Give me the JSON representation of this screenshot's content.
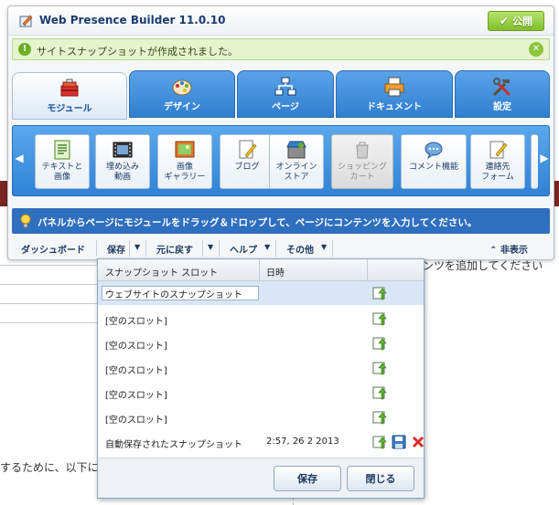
{
  "app": {
    "title": "Web Presence Builder 11.0.10",
    "publish_label": "公開"
  },
  "notice": {
    "text": "サイトスナップショットが作成されました。"
  },
  "tabs": [
    {
      "label": "モジュール",
      "icon": "toolbox-icon",
      "active": true
    },
    {
      "label": "デザイン",
      "icon": "palette-icon",
      "active": false
    },
    {
      "label": "ページ",
      "icon": "sitemap-icon",
      "active": false
    },
    {
      "label": "ドキュメント",
      "icon": "printer-icon",
      "active": false
    },
    {
      "label": "設定",
      "icon": "tools-icon",
      "active": false
    }
  ],
  "modules": [
    {
      "label": "テキストと画像",
      "lines": [
        "テキストと",
        "画像"
      ],
      "icon": "text-image-icon",
      "disabled": false
    },
    {
      "label": "埋め込み動画",
      "lines": [
        "埋め込み",
        "動画"
      ],
      "icon": "video-icon",
      "disabled": false
    },
    {
      "label": "画像ギャラリー",
      "lines": [
        "画像",
        "ギャラリー"
      ],
      "icon": "gallery-icon",
      "disabled": false
    },
    {
      "label": "ブログ",
      "lines": [
        "ブログ"
      ],
      "icon": "blog-icon",
      "disabled": false
    },
    {
      "label": "オンラインストア",
      "lines": [
        "オンライン",
        "ストア"
      ],
      "icon": "store-icon",
      "disabled": false
    },
    {
      "label": "ショッピングカート",
      "lines": [
        "ショッピング",
        "カート"
      ],
      "icon": "cart-icon",
      "disabled": true
    },
    {
      "label": "コメント機能",
      "lines": [
        "コメント機能"
      ],
      "icon": "comment-icon",
      "disabled": false
    },
    {
      "label": "連絡先フォーム",
      "lines": [
        "連絡先",
        "フォーム"
      ],
      "icon": "contact-form-icon",
      "disabled": false
    }
  ],
  "hint": {
    "text": "パネルからページにモジュールをドラッグ＆ドロップして、ページにコンテンツを入力してください。"
  },
  "toolbar": {
    "dashboard": "ダッシュボード",
    "save": "保存",
    "undo": "元に戻す",
    "help": "ヘルプ",
    "other": "その他",
    "hide": "非表示"
  },
  "snapshot_panel": {
    "col_slot": "スナップショット スロット",
    "col_date": "日時",
    "rows": [
      {
        "name": "ウェブサイトのスナップショット",
        "date": "",
        "editing": true,
        "autosave": false
      },
      {
        "name": "[空のスロット]",
        "date": "",
        "editing": false,
        "autosave": false
      },
      {
        "name": "[空のスロット]",
        "date": "",
        "editing": false,
        "autosave": false
      },
      {
        "name": "[空のスロット]",
        "date": "",
        "editing": false,
        "autosave": false
      },
      {
        "name": "[空のスロット]",
        "date": "",
        "editing": false,
        "autosave": false
      },
      {
        "name": "[空のスロット]",
        "date": "",
        "editing": false,
        "autosave": false
      },
      {
        "name": "自動保存されたスナップショット",
        "date": "2:57, 26 2 2013",
        "editing": false,
        "autosave": true
      }
    ],
    "save_label": "保存",
    "close_label": "閉じる"
  },
  "background": {
    "right_text": "ンツを追加してください",
    "left_text": "するために、以下に"
  },
  "colors": {
    "accent_blue": "#2f7fd0",
    "publish_green": "#7fbe2b",
    "notice_bg": "#e7f3cf",
    "hint_bg": "#2f6fbf"
  }
}
